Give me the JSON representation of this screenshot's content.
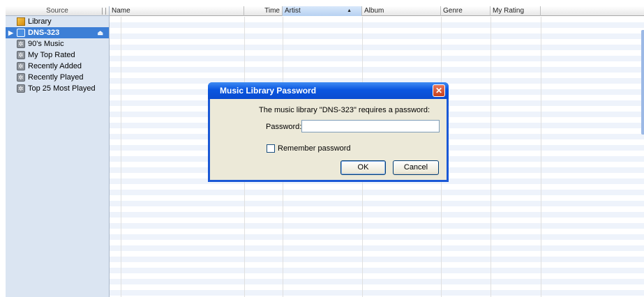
{
  "sidebar": {
    "header": "Source",
    "items": [
      {
        "label": "Library",
        "icon": "library-icon"
      },
      {
        "label": "DNS-323",
        "icon": "shared-library-icon"
      },
      {
        "label": "90's Music",
        "icon": "smart-playlist-icon"
      },
      {
        "label": "My Top Rated",
        "icon": "smart-playlist-icon"
      },
      {
        "label": "Recently Added",
        "icon": "smart-playlist-icon"
      },
      {
        "label": "Recently Played",
        "icon": "smart-playlist-icon"
      },
      {
        "label": "Top 25 Most Played",
        "icon": "smart-playlist-icon"
      }
    ],
    "arrow_glyph": "▶",
    "eject_glyph": "⏏"
  },
  "columns": {
    "name": "Name",
    "time": "Time",
    "artist": "Artist",
    "album": "Album",
    "genre": "Genre",
    "rating": "My Rating",
    "sort_glyph": "▲"
  },
  "dialog": {
    "title": "Music Library Password",
    "close_glyph": "✕",
    "prompt": "The music library \"DNS-323\" requires a password:",
    "password_label": "Password:",
    "password_value": "",
    "remember_label": "Remember password",
    "remember_checked": false,
    "ok_label": "OK",
    "cancel_label": "Cancel"
  },
  "colors": {
    "selection": "#3d7fd6",
    "titlebar": "#0a56e0",
    "dialog_bg": "#ece9d8"
  }
}
